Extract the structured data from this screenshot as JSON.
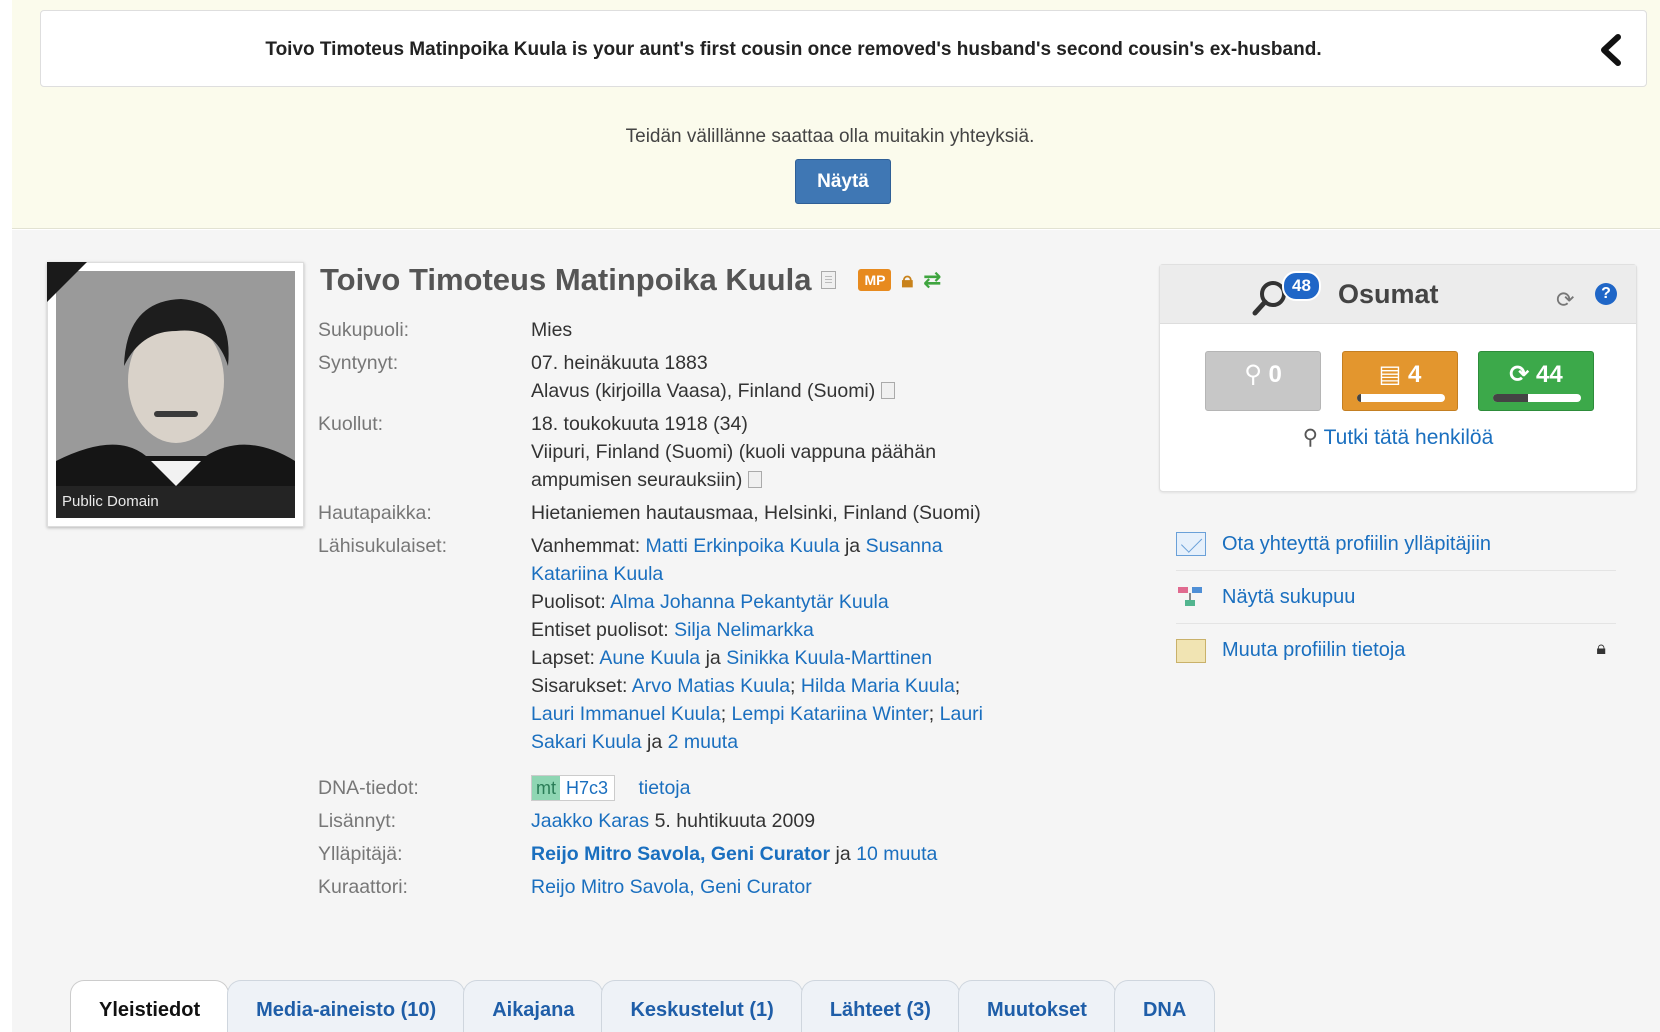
{
  "relationship": {
    "text": "Toivo Timoteus Matinpoika Kuula is your aunt's first cousin once removed's husband's second cousin's ex-husband."
  },
  "connections": {
    "text": "Teidän välillänne saattaa olla muitakin yhteyksiä.",
    "button": "Näytä"
  },
  "profile": {
    "photo_caption": "Public Domain",
    "name": "Toivo Timoteus Matinpoika Kuula",
    "badge": "MP"
  },
  "facts": {
    "gender_label": "Sukupuoli:",
    "gender": "Mies",
    "born_label": "Syntynyt:",
    "born_date": "07. heinäkuuta 1883",
    "born_place": "Alavus (kirjoilla Vaasa), Finland (Suomi)",
    "died_label": "Kuollut:",
    "died_date": "18. toukokuuta 1918 (34)",
    "died_place": "Viipuri, Finland (Suomi) (kuoli vappuna päähän ampumisen seurauksiin)",
    "burial_label": "Hautapaikka:",
    "burial": "Hietaniemen hautausmaa, Helsinki, Finland (Suomi)",
    "family_label": "Lähisukulaiset:",
    "parents_label": "Vanhemmat:",
    "parent1": "Matti Erkinpoika Kuula",
    "and": "ja",
    "parent2": "Susanna Katariina Kuula",
    "spouses_label": "Puolisot:",
    "spouse": "Alma Johanna Pekantytär Kuula",
    "exspouses_label": "Entiset puolisot:",
    "exspouse": "Silja Nelimarkka",
    "children_label": "Lapset:",
    "child1": "Aune Kuula",
    "child2": "Sinikka Kuula-Marttinen",
    "siblings_label": "Sisarukset:",
    "sibling1": "Arvo Matias Kuula",
    "sibling2": "Hilda Maria Kuula",
    "sibling3": "Lauri Immanuel Kuula",
    "sibling4": "Lempi Katariina Winter",
    "sibling5": "Lauri Sakari Kuula",
    "siblings_more": "2 muuta",
    "sep": ";",
    "dna_label": "DNA-tiedot:",
    "dna_tag": "mt",
    "dna_haplo": "H7c3",
    "dna_info": "tietoja",
    "added_label": "Lisännyt:",
    "added_by": "Jaakko Karas",
    "added_date": "5. huhtikuuta 2009",
    "manager_label": "Ylläpitäjä:",
    "manager": "Reijo Mitro Savola, Geni Curator",
    "managers_more": "10 muuta",
    "curator_label": "Kuraattori:",
    "curator": "Reijo Mitro Savola, Geni Curator"
  },
  "matches": {
    "count": "48",
    "title": "Osumat",
    "help": "?",
    "tree_count": "0",
    "record_count": "4",
    "record_progress": 0.05,
    "smart_count": "44",
    "smart_progress": 0.4,
    "research": "Tutki tätä henkilöä"
  },
  "actions": [
    {
      "label": "Ota yhteyttä profiilin ylläpitäjiin"
    },
    {
      "label": "Näytä sukupuu"
    },
    {
      "label": "Muuta profiilin tietoja"
    }
  ],
  "tabs": [
    {
      "label": "Yleistiedot"
    },
    {
      "label": "Media-aineisto (10)"
    },
    {
      "label": "Aikajana"
    },
    {
      "label": "Keskustelut (1)"
    },
    {
      "label": "Lähteet (3)"
    },
    {
      "label": "Muutokset"
    },
    {
      "label": "DNA"
    }
  ],
  "colors": {
    "link": "#1a6fbf",
    "button": "#3f77b4",
    "orange": "#e3962e",
    "green": "#3ca94a"
  }
}
